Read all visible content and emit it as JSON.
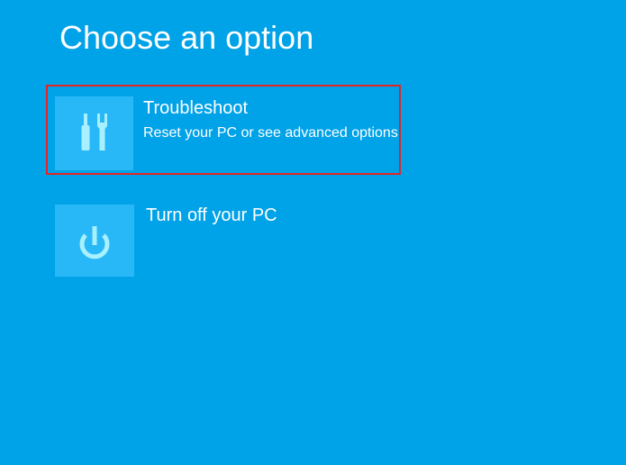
{
  "page": {
    "title": "Choose an option"
  },
  "options": [
    {
      "title": "Troubleshoot",
      "description": "Reset your PC or see advanced options",
      "icon": "tools-icon",
      "selected": true
    },
    {
      "title": "Turn off your PC",
      "icon": "power-icon",
      "selected": false
    }
  ],
  "colors": {
    "background": "#00a2e8",
    "tile": "#28b8f8",
    "icon": "#a8f0ff",
    "selection_border": "#e32526",
    "text": "#ffffff"
  }
}
